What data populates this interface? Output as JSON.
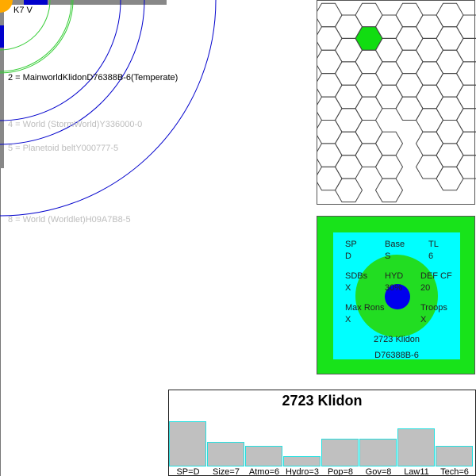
{
  "system": {
    "star": "K7 V",
    "orbits": [
      {
        "text": "2 = MainworldKlidonD76388B-6(Temperate)",
        "style": "main"
      },
      {
        "text": "4 = World  (StormWorld)Y336000-0",
        "style": "dim"
      },
      {
        "text": "5 = Planetoid beltY000777-5",
        "style": "dim"
      },
      {
        "text": "8 = World  (Worldlet)H09A7B8-5",
        "style": "dim"
      }
    ]
  },
  "card": {
    "sp_label": "SP",
    "sp_value": "D",
    "base_label": "Base",
    "base_value": "S",
    "tl_label": "TL",
    "tl_value": "6",
    "sdbs_label": "SDBs",
    "sdbs_value": "X",
    "hyd_label": "HYD",
    "hyd_value": "30%",
    "def_label": "DEF CF",
    "def_value": "20",
    "maxrons_label": "Max Rons",
    "maxrons_value": "X",
    "troops_label": "Troops",
    "troops_value": "X",
    "name": "2723 Klidon",
    "uwp": "D76388B-6"
  },
  "chart_data": {
    "type": "bar",
    "title": "2723 Klidon",
    "categories": [
      "SP=D",
      "Size=7",
      "Atmo=6",
      "Hydro=3",
      "Pop=8",
      "Gov=8",
      "Law11",
      "Tech=6"
    ],
    "values": [
      13,
      7,
      6,
      3,
      8,
      8,
      11,
      6
    ],
    "ylim": [
      0,
      22
    ]
  },
  "colors": {
    "orbit_blue": "#0000cc",
    "habitable_green": "#33cc33",
    "card_outer": "#18e31a",
    "card_inner": "#00ffff",
    "world_green": "#22dd22",
    "world_blue": "#0000ee",
    "bar_fill": "#c0c0c0",
    "bar_border": "#22e0e0",
    "highlight_hex": "#11dd11"
  }
}
